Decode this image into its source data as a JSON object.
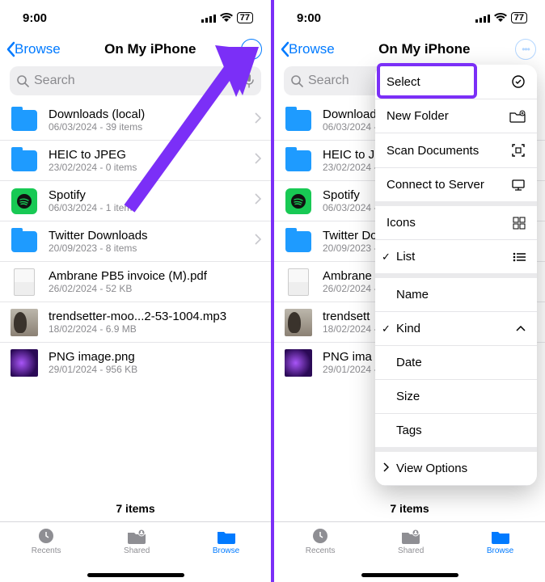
{
  "status": {
    "time": "9:00",
    "battery": "77"
  },
  "nav": {
    "back": "Browse",
    "title": "On My iPhone"
  },
  "search": {
    "placeholder": "Search"
  },
  "folders": [
    {
      "name": "Downloads (local)",
      "sub": "06/03/2024 - 39 items",
      "type": "folder"
    },
    {
      "name": "HEIC to JPEG",
      "sub": "23/02/2024 - 0 items",
      "type": "folder"
    },
    {
      "name": "Spotify",
      "sub": "06/03/2024 - 1 item",
      "type": "spotify"
    },
    {
      "name": "Twitter Downloads",
      "sub": "20/09/2023 - 8 items",
      "type": "folder"
    },
    {
      "name": "Ambrane PB5 invoice (M).pdf",
      "sub": "26/02/2024 - 52 KB",
      "type": "doc"
    },
    {
      "name": "trendsetter-moo...2-53-1004.mp3",
      "sub": "18/02/2024 - 6.9 MB",
      "type": "guy"
    },
    {
      "name": "PNG image.png",
      "sub": "29/01/2024 - 956 KB",
      "type": "png"
    }
  ],
  "folders2_truncated": [
    {
      "name": "Downloads (local)",
      "sub": "06/03/2024 - 39"
    },
    {
      "name": "HEIC to JPEG",
      "sub": "23/02/2024 - 0"
    },
    {
      "name": "Spotify",
      "sub": "06/03/2024 - 1"
    },
    {
      "name": "Twitter Do",
      "sub": "20/09/2023 - 8"
    },
    {
      "name": "Ambrane",
      "sub": "26/02/2024 - 5"
    },
    {
      "name": "trendsett",
      "sub": "18/02/2024 - 6"
    },
    {
      "name": "PNG ima",
      "sub": "29/01/2024 - 9"
    }
  ],
  "count": "7 items",
  "tabs": {
    "recents": "Recents",
    "shared": "Shared",
    "browse": "Browse"
  },
  "menu": {
    "select": "Select",
    "newfolder": "New Folder",
    "scan": "Scan Documents",
    "connect": "Connect to Server",
    "icons": "Icons",
    "list": "List",
    "name": "Name",
    "kind": "Kind",
    "date": "Date",
    "size": "Size",
    "tags": "Tags",
    "viewopts": "View Options"
  }
}
